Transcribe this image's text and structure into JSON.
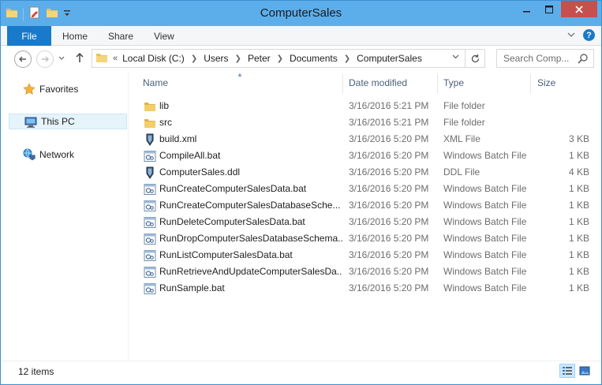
{
  "window": {
    "title": "ComputerSales"
  },
  "ribbon": {
    "file_label": "File",
    "home_label": "Home",
    "share_label": "Share",
    "view_label": "View",
    "help_glyph": "?"
  },
  "nav": {
    "crumb_prefix": "«",
    "crumbs": [
      "Local Disk (C:)",
      "Users",
      "Peter",
      "Documents",
      "ComputerSales"
    ],
    "search_placeholder": "Search Comp..."
  },
  "sidebar": {
    "items": [
      {
        "label": "Favorites",
        "icon": "star-icon"
      },
      {
        "label": "This PC",
        "icon": "computer-icon"
      },
      {
        "label": "Network",
        "icon": "network-icon"
      }
    ]
  },
  "columns": {
    "name": "Name",
    "date": "Date modified",
    "type": "Type",
    "size": "Size"
  },
  "files": [
    {
      "name": "lib",
      "date": "3/16/2016 5:21 PM",
      "type": "File folder",
      "size": "",
      "icon": "folder"
    },
    {
      "name": "src",
      "date": "3/16/2016 5:21 PM",
      "type": "File folder",
      "size": "",
      "icon": "folder"
    },
    {
      "name": "build.xml",
      "date": "3/16/2016 5:20 PM",
      "type": "XML File",
      "size": "3 KB",
      "icon": "shield"
    },
    {
      "name": "CompileAll.bat",
      "date": "3/16/2016 5:20 PM",
      "type": "Windows Batch File",
      "size": "1 KB",
      "icon": "batch"
    },
    {
      "name": "ComputerSales.ddl",
      "date": "3/16/2016 5:20 PM",
      "type": "DDL File",
      "size": "4 KB",
      "icon": "shield"
    },
    {
      "name": "RunCreateComputerSalesData.bat",
      "date": "3/16/2016 5:20 PM",
      "type": "Windows Batch File",
      "size": "1 KB",
      "icon": "batch"
    },
    {
      "name": "RunCreateComputerSalesDatabaseSche...",
      "date": "3/16/2016 5:20 PM",
      "type": "Windows Batch File",
      "size": "1 KB",
      "icon": "batch"
    },
    {
      "name": "RunDeleteComputerSalesData.bat",
      "date": "3/16/2016 5:20 PM",
      "type": "Windows Batch File",
      "size": "1 KB",
      "icon": "batch"
    },
    {
      "name": "RunDropComputerSalesDatabaseSchema...",
      "date": "3/16/2016 5:20 PM",
      "type": "Windows Batch File",
      "size": "1 KB",
      "icon": "batch"
    },
    {
      "name": "RunListComputerSalesData.bat",
      "date": "3/16/2016 5:20 PM",
      "type": "Windows Batch File",
      "size": "1 KB",
      "icon": "batch"
    },
    {
      "name": "RunRetrieveAndUpdateComputerSalesDa...",
      "date": "3/16/2016 5:20 PM",
      "type": "Windows Batch File",
      "size": "1 KB",
      "icon": "batch"
    },
    {
      "name": "RunSample.bat",
      "date": "3/16/2016 5:20 PM",
      "type": "Windows Batch File",
      "size": "1 KB",
      "icon": "batch"
    }
  ],
  "status": {
    "item_count": "12 items"
  },
  "colors": {
    "titlebar": "#5caeeb",
    "file_tab": "#1979ca",
    "close": "#c7504f",
    "selection": "#e5f3fb"
  }
}
